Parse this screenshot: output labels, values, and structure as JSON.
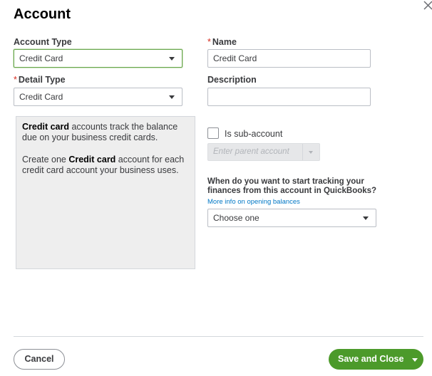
{
  "dialog": {
    "title": "Account",
    "close_icon": "close-x-icon"
  },
  "form": {
    "account_type": {
      "label": "Account Type",
      "value": "Credit Card"
    },
    "detail_type": {
      "label": "Detail Type",
      "required_mark": "*",
      "value": "Credit Card"
    },
    "name": {
      "label": "Name",
      "required_mark": "*",
      "value": "Credit Card"
    },
    "description": {
      "label": "Description",
      "value": ""
    },
    "sub_account": {
      "label": "Is sub-account",
      "checked": false
    },
    "parent_account": {
      "placeholder": "Enter parent account"
    },
    "tracking_question": "When do you want to start tracking your finances from this account in QuickBooks?",
    "opening_balance_link": "More info on opening balances",
    "tracking_start": {
      "value": "Choose one"
    }
  },
  "info_box": {
    "para1_bold": "Credit card",
    "para1_rest": " accounts track the balance due on your business credit cards.",
    "para2_start": "Create one ",
    "para2_bold": "Credit card",
    "para2_rest": " account for each credit card account your business uses."
  },
  "footer": {
    "cancel_label": "Cancel",
    "save_label": "Save and Close"
  },
  "colors": {
    "primary_green": "#4c9a2a",
    "required_red": "#d52b1e",
    "link_blue": "#0077c5"
  }
}
